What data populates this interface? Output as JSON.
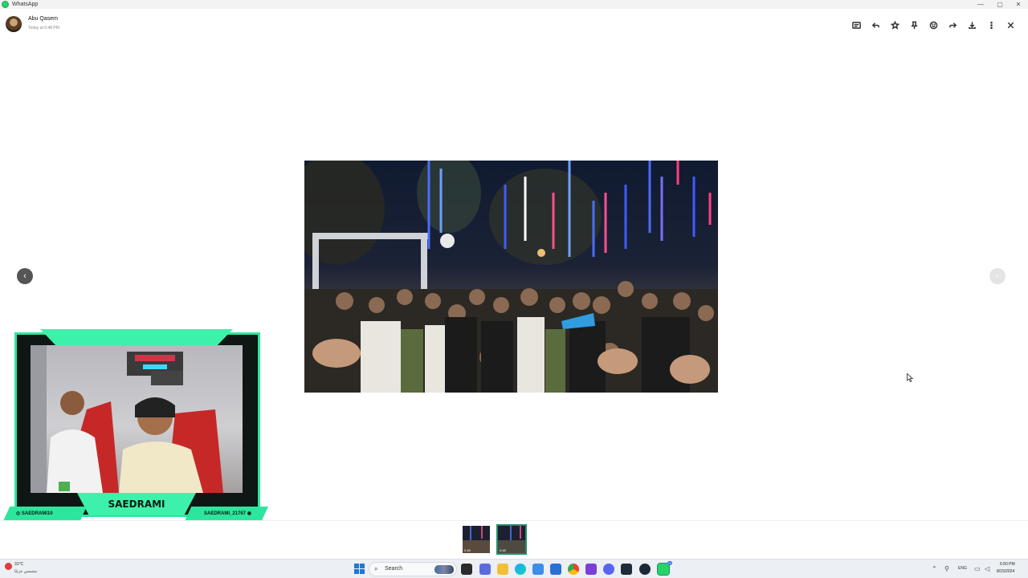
{
  "window": {
    "app_title": "WhatsApp",
    "minimize": "—",
    "maximize": "▢",
    "close": "✕"
  },
  "header": {
    "sender_name": "Abu Qasem",
    "timestamp": "Today at 6:48 PM"
  },
  "toolbar": {
    "items": [
      "caption-icon",
      "reply-icon",
      "star-icon",
      "pin-icon",
      "react-icon",
      "forward-icon",
      "download-icon",
      "more-icon",
      "close-icon"
    ]
  },
  "navigation": {
    "prev": "‹",
    "next": "›"
  },
  "thumbnails": [
    {
      "duration": "0:48",
      "active": false
    },
    {
      "duration": "0:48",
      "active": true
    }
  ],
  "stream_overlay": {
    "streamer_name": "SAEDRAMI",
    "instagram_handle": "SAEDRAMI10",
    "discord_handle": "SAEDRAMI_21767",
    "accent_color": "#3ef1aa"
  },
  "taskbar": {
    "weather_temp": "31°C",
    "weather_desc": "مشمس جزئيًا",
    "search_label": "Search",
    "language": "ENG",
    "time": "6:50 PM",
    "date": "8/15/2024",
    "whatsapp_badge": "20"
  }
}
